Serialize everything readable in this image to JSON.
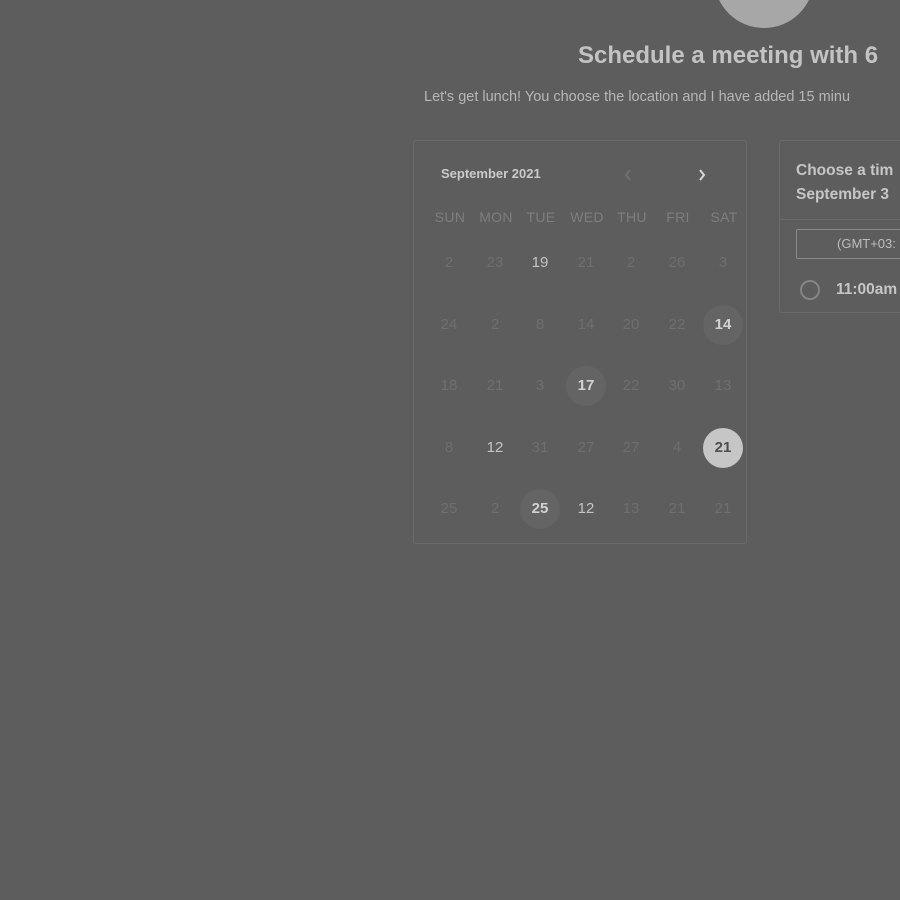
{
  "header": {
    "title": "Schedule a meeting with 6",
    "subtitle": "Let's get lunch! You choose the location and I have added 15 minu"
  },
  "calendar": {
    "month_label": "September 2021",
    "prev_icon": "chevron-left-icon",
    "next_icon": "chevron-right-icon",
    "weekdays": [
      "SUN",
      "MON",
      "TUE",
      "WED",
      "THU",
      "FRI",
      "SAT"
    ],
    "weeks": [
      [
        "2",
        "23",
        "19",
        "21",
        "2",
        "26",
        "3"
      ],
      [
        "24",
        "2",
        "8",
        "14",
        "20",
        "22",
        "14"
      ],
      [
        "18",
        "21",
        "3",
        "17",
        "22",
        "30",
        "13"
      ],
      [
        "8",
        "12",
        "31",
        "27",
        "27",
        "4",
        "21"
      ],
      [
        "25",
        "2",
        "25",
        "12",
        "13",
        "21",
        "21"
      ]
    ],
    "available_days": [
      "19",
      "12",
      "17",
      "14",
      "25",
      "12",
      "21"
    ],
    "selected_day": "21"
  },
  "time_panel": {
    "heading_line1": "Choose a tim",
    "heading_line2": "September 3",
    "timezone": "(GMT+03:",
    "slots": [
      {
        "label": "11:00am"
      }
    ]
  }
}
